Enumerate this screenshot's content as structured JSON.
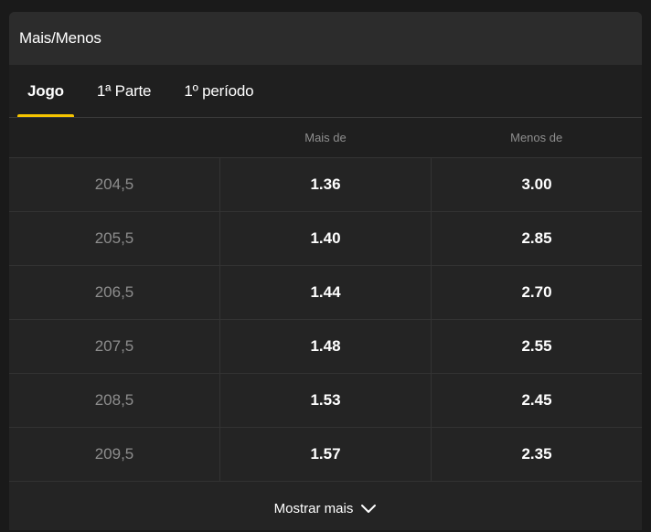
{
  "panel": {
    "title": "Mais/Menos"
  },
  "tabs": [
    {
      "label": "Jogo",
      "active": true
    },
    {
      "label": "1ª Parte",
      "active": false
    },
    {
      "label": "1º período",
      "active": false
    }
  ],
  "table": {
    "headers": [
      "",
      "Mais de",
      "Menos de"
    ],
    "rows": [
      {
        "line": "204,5",
        "over": "1.36",
        "under": "3.00"
      },
      {
        "line": "205,5",
        "over": "1.40",
        "under": "2.85"
      },
      {
        "line": "206,5",
        "over": "1.44",
        "under": "2.70"
      },
      {
        "line": "207,5",
        "over": "1.48",
        "under": "2.55"
      },
      {
        "line": "208,5",
        "over": "1.53",
        "under": "2.45"
      },
      {
        "line": "209,5",
        "over": "1.57",
        "under": "2.35"
      }
    ]
  },
  "footer": {
    "show_more_label": "Mostrar mais",
    "icon": "chevron-down-icon"
  },
  "colors": {
    "accent": "#f5c400"
  }
}
